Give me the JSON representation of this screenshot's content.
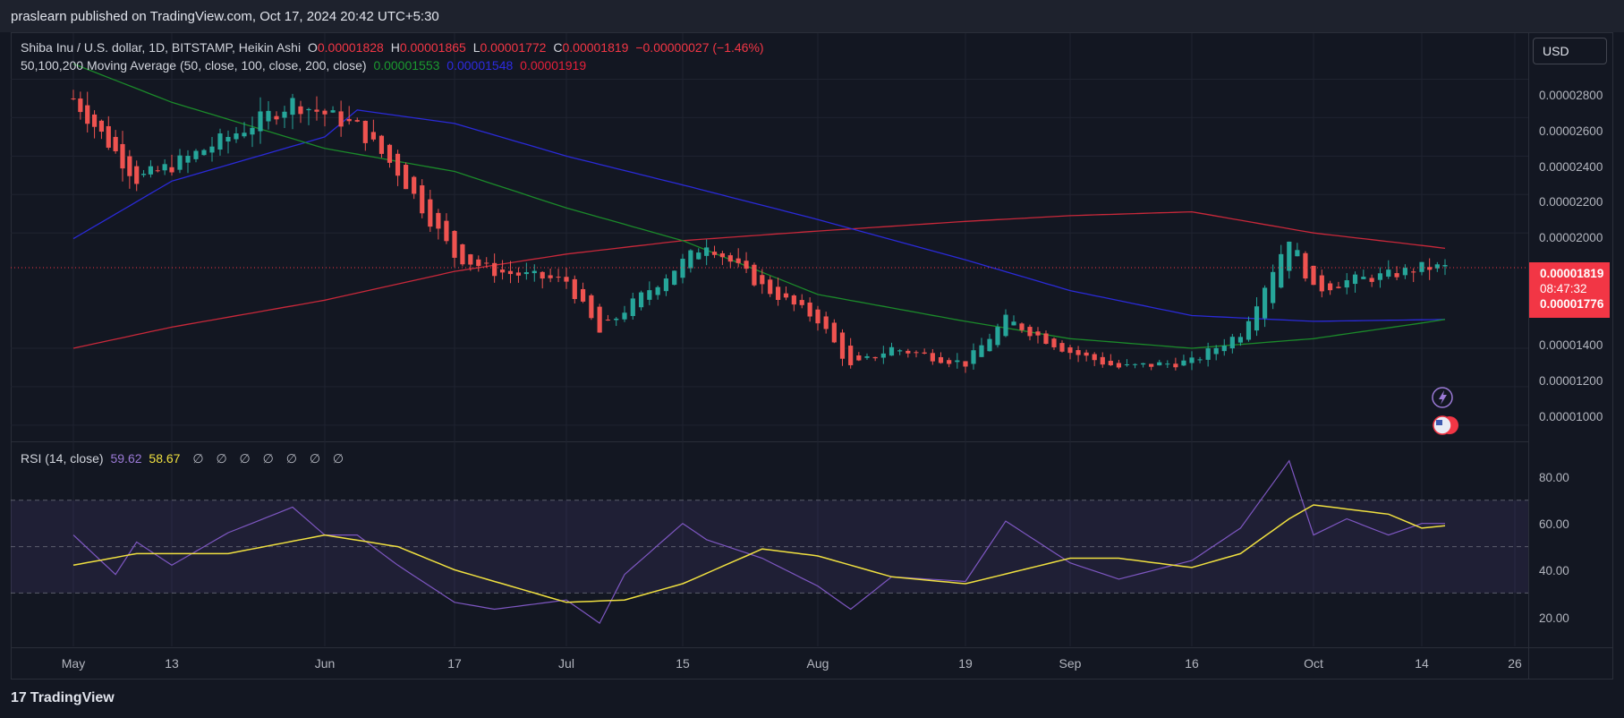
{
  "publisher": {
    "text": "praslearn published on TradingView.com, Oct 17, 2024 20:42 UTC+5:30"
  },
  "header": {
    "symbol": "Shiba Inu / U.S. dollar, 1D, BITSTAMP, Heikin Ashi",
    "o_label": "O",
    "o_val": "0.00001828",
    "h_label": "H",
    "h_val": "0.00001865",
    "l_label": "L",
    "l_val": "0.00001772",
    "c_label": "C",
    "c_val": "0.00001819",
    "change": "−0.00000027 (−1.46%)"
  },
  "ma_legend": {
    "label": "50,100,200 Moving Average (50, close, 100, close, 200, close)",
    "ma50": "0.00001553",
    "ma100": "0.00001548",
    "ma200": "0.00001919"
  },
  "rsi_legend": {
    "label": "RSI (14, close)",
    "rsi": "59.62",
    "rsi_ma": "58.67",
    "slashes": [
      "∅",
      "∅",
      "∅",
      "∅",
      "∅",
      "∅",
      "∅"
    ]
  },
  "currency_button": "USD",
  "price_tag": {
    "price": "0.00001819",
    "countdown": "08:47:32",
    "low": "0.00001776"
  },
  "brand": "TradingView",
  "chart_data": {
    "type": "candlestick",
    "price_axis_ticks": [
      "0.00002800",
      "0.00002600",
      "0.00002400",
      "0.00002200",
      "0.00002000",
      "0.00001400",
      "0.00001200",
      "0.00001000"
    ],
    "price_ylim": [
      9.2e-06,
      3.04e-05
    ],
    "rsi_axis_ticks": [
      "80.00",
      "60.00",
      "40.00",
      "20.00"
    ],
    "rsi_ylim": [
      7,
      95
    ],
    "rsi_bands": [
      30,
      50,
      70
    ],
    "x_ticks": [
      "May",
      "13",
      "Jun",
      "17",
      "Jul",
      "15",
      "Aug",
      "19",
      "Sep",
      "16",
      "Oct",
      "14",
      "26"
    ],
    "dates": [
      "Apr 29",
      "May 13",
      "Jun 1",
      "Jun 17",
      "Jul 1",
      "Jul 15",
      "Aug 1",
      "Aug 19",
      "Sep 1",
      "Sep 16",
      "Oct 1",
      "Oct 14",
      "Oct 26"
    ],
    "close_path": [
      [
        "Apr 29",
        2.7e-05
      ],
      [
        "May 5",
        2.42e-05
      ],
      [
        "May 8",
        2.28e-05
      ],
      [
        "May 13",
        2.35e-05
      ],
      [
        "May 20",
        2.5e-05
      ],
      [
        "May 28",
        2.68e-05
      ],
      [
        "Jun 1",
        2.62e-05
      ],
      [
        "Jun 5",
        2.55e-05
      ],
      [
        "Jun 10",
        2.32e-05
      ],
      [
        "Jun 17",
        1.88e-05
      ],
      [
        "Jun 22",
        1.8e-05
      ],
      [
        "Jul 1",
        1.75e-05
      ],
      [
        "Jul 5",
        1.48e-05
      ],
      [
        "Jul 8",
        1.6e-05
      ],
      [
        "Jul 15",
        1.85e-05
      ],
      [
        "Jul 18",
        1.95e-05
      ],
      [
        "Jul 25",
        1.72e-05
      ],
      [
        "Aug 1",
        1.55e-05
      ],
      [
        "Aug 5",
        1.3e-05
      ],
      [
        "Aug 10",
        1.4e-05
      ],
      [
        "Aug 19",
        1.32e-05
      ],
      [
        "Aug 24",
        1.55e-05
      ],
      [
        "Sep 1",
        1.38e-05
      ],
      [
        "Sep 7",
        1.3e-05
      ],
      [
        "Sep 16",
        1.33e-05
      ],
      [
        "Sep 22",
        1.48e-05
      ],
      [
        "Sep 28",
        1.98e-05
      ],
      [
        "Oct 1",
        1.7e-05
      ],
      [
        "Oct 5",
        1.75e-05
      ],
      [
        "Oct 10",
        1.78e-05
      ],
      [
        "Oct 14",
        1.82e-05
      ],
      [
        "Oct 17",
        1.82e-05
      ]
    ],
    "ma50_path": [
      [
        "Apr 29",
        2.88e-05
      ],
      [
        "May 13",
        2.68e-05
      ],
      [
        "Jun 1",
        2.44e-05
      ],
      [
        "Jun 17",
        2.32e-05
      ],
      [
        "Jul 1",
        2.13e-05
      ],
      [
        "Jul 15",
        1.96e-05
      ],
      [
        "Aug 1",
        1.68e-05
      ],
      [
        "Aug 19",
        1.54e-05
      ],
      [
        "Sep 1",
        1.45e-05
      ],
      [
        "Sep 16",
        1.4e-05
      ],
      [
        "Oct 1",
        1.45e-05
      ],
      [
        "Oct 17",
        1.55e-05
      ]
    ],
    "ma100_path": [
      [
        "Apr 29",
        1.97e-05
      ],
      [
        "May 13",
        2.27e-05
      ],
      [
        "Jun 1",
        2.5e-05
      ],
      [
        "Jun 5",
        2.64e-05
      ],
      [
        "Jun 17",
        2.57e-05
      ],
      [
        "Jul 1",
        2.4e-05
      ],
      [
        "Jul 15",
        2.25e-05
      ],
      [
        "Aug 1",
        2.07e-05
      ],
      [
        "Aug 19",
        1.86e-05
      ],
      [
        "Sep 1",
        1.7e-05
      ],
      [
        "Sep 16",
        1.57e-05
      ],
      [
        "Oct 1",
        1.54e-05
      ],
      [
        "Oct 17",
        1.55e-05
      ]
    ],
    "ma200_path": [
      [
        "Apr 29",
        1.4e-05
      ],
      [
        "May 13",
        1.51e-05
      ],
      [
        "Jun 1",
        1.65e-05
      ],
      [
        "Jun 17",
        1.8e-05
      ],
      [
        "Jul 1",
        1.89e-05
      ],
      [
        "Jul 15",
        1.96e-05
      ],
      [
        "Aug 1",
        2.01e-05
      ],
      [
        "Aug 19",
        2.06e-05
      ],
      [
        "Sep 1",
        2.09e-05
      ],
      [
        "Sep 16",
        2.11e-05
      ],
      [
        "Oct 1",
        2e-05
      ],
      [
        "Oct 17",
        1.92e-05
      ]
    ],
    "rsi_series": [
      [
        "Apr 29",
        55
      ],
      [
        "May 5",
        38
      ],
      [
        "May 8",
        52
      ],
      [
        "May 13",
        42
      ],
      [
        "May 20",
        56
      ],
      [
        "May 28",
        67
      ],
      [
        "Jun 1",
        55
      ],
      [
        "Jun 5",
        55
      ],
      [
        "Jun 10",
        42
      ],
      [
        "Jun 17",
        26
      ],
      [
        "Jun 22",
        23
      ],
      [
        "Jul 1",
        27
      ],
      [
        "Jul 5",
        17
      ],
      [
        "Jul 8",
        38
      ],
      [
        "Jul 15",
        60
      ],
      [
        "Jul 18",
        53
      ],
      [
        "Jul 25",
        45
      ],
      [
        "Aug 1",
        33
      ],
      [
        "Aug 5",
        23
      ],
      [
        "Aug 10",
        37
      ],
      [
        "Aug 19",
        35
      ],
      [
        "Aug 24",
        61
      ],
      [
        "Sep 1",
        43
      ],
      [
        "Sep 7",
        36
      ],
      [
        "Sep 16",
        44
      ],
      [
        "Sep 22",
        58
      ],
      [
        "Sep 28",
        87
      ],
      [
        "Oct 1",
        55
      ],
      [
        "Oct 5",
        62
      ],
      [
        "Oct 10",
        55
      ],
      [
        "Oct 14",
        60
      ],
      [
        "Oct 17",
        60
      ]
    ],
    "rsi_ma_series": [
      [
        "Apr 29",
        42
      ],
      [
        "May 8",
        47
      ],
      [
        "May 20",
        47
      ],
      [
        "Jun 1",
        55
      ],
      [
        "Jun 10",
        50
      ],
      [
        "Jun 17",
        40
      ],
      [
        "Jul 1",
        26
      ],
      [
        "Jul 8",
        27
      ],
      [
        "Jul 15",
        34
      ],
      [
        "Jul 25",
        49
      ],
      [
        "Aug 1",
        46
      ],
      [
        "Aug 10",
        37
      ],
      [
        "Aug 19",
        34
      ],
      [
        "Sep 1",
        45
      ],
      [
        "Sep 7",
        45
      ],
      [
        "Sep 16",
        41
      ],
      [
        "Sep 22",
        47
      ],
      [
        "Sep 28",
        62
      ],
      [
        "Oct 1",
        68
      ],
      [
        "Oct 10",
        64
      ],
      [
        "Oct 14",
        58
      ],
      [
        "Oct 17",
        59
      ]
    ],
    "colors": {
      "up": "#26a69a",
      "down": "#ef5350",
      "ma50": "#1b8a2a",
      "ma100": "#2a2ad8",
      "ma200": "#c8283a",
      "rsi": "#7e57c2",
      "rsi_ma": "#f0e040"
    }
  }
}
